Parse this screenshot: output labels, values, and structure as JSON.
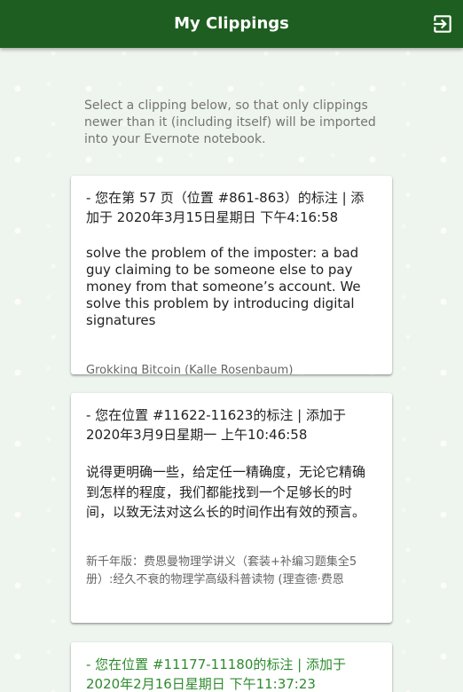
{
  "app_bar": {
    "title": "My Clippings",
    "logout_icon": "logout-icon",
    "color": "#1e5e20"
  },
  "intro": "Select a clipping below, so that only clippings newer than it (including itself) will be imported into your Evernote notebook.",
  "clippings": [
    {
      "header": "- 您在第 57 页（位置 #861-863）的标注 | 添加于 2020年3月15日星期日 下午4:16:58",
      "text": "solve the problem of the imposter: a bad guy claiming to be someone else to pay money from that someone’s account. We solve this problem by introducing digital signatures",
      "source": "Grokking Bitcoin (Kalle Rosenbaum)"
    },
    {
      "header": "- 您在位置 #11622-11623的标注 | 添加于 2020年3月9日星期一 上午10:46:58",
      "text": "说得更明确一些，给定任一精确度，无论它精确到怎样的程度，我们都能找到一个足够长的时间，以致无法对这么长的时间作出有效的预言。",
      "source": "新千年版：费恩曼物理学讲义（套装+补编习题集全5册）:经久不衰的物理学高级科普读物 (理查德·费恩"
    },
    {
      "header": "- 您在位置 #11177-11180的标注 | 添加于 2020年2月16日星期日 下午11:37:23",
      "text": "",
      "source": ""
    }
  ],
  "colors": {
    "selected_header": "#2e8b2e",
    "background": "#eef4ee"
  }
}
